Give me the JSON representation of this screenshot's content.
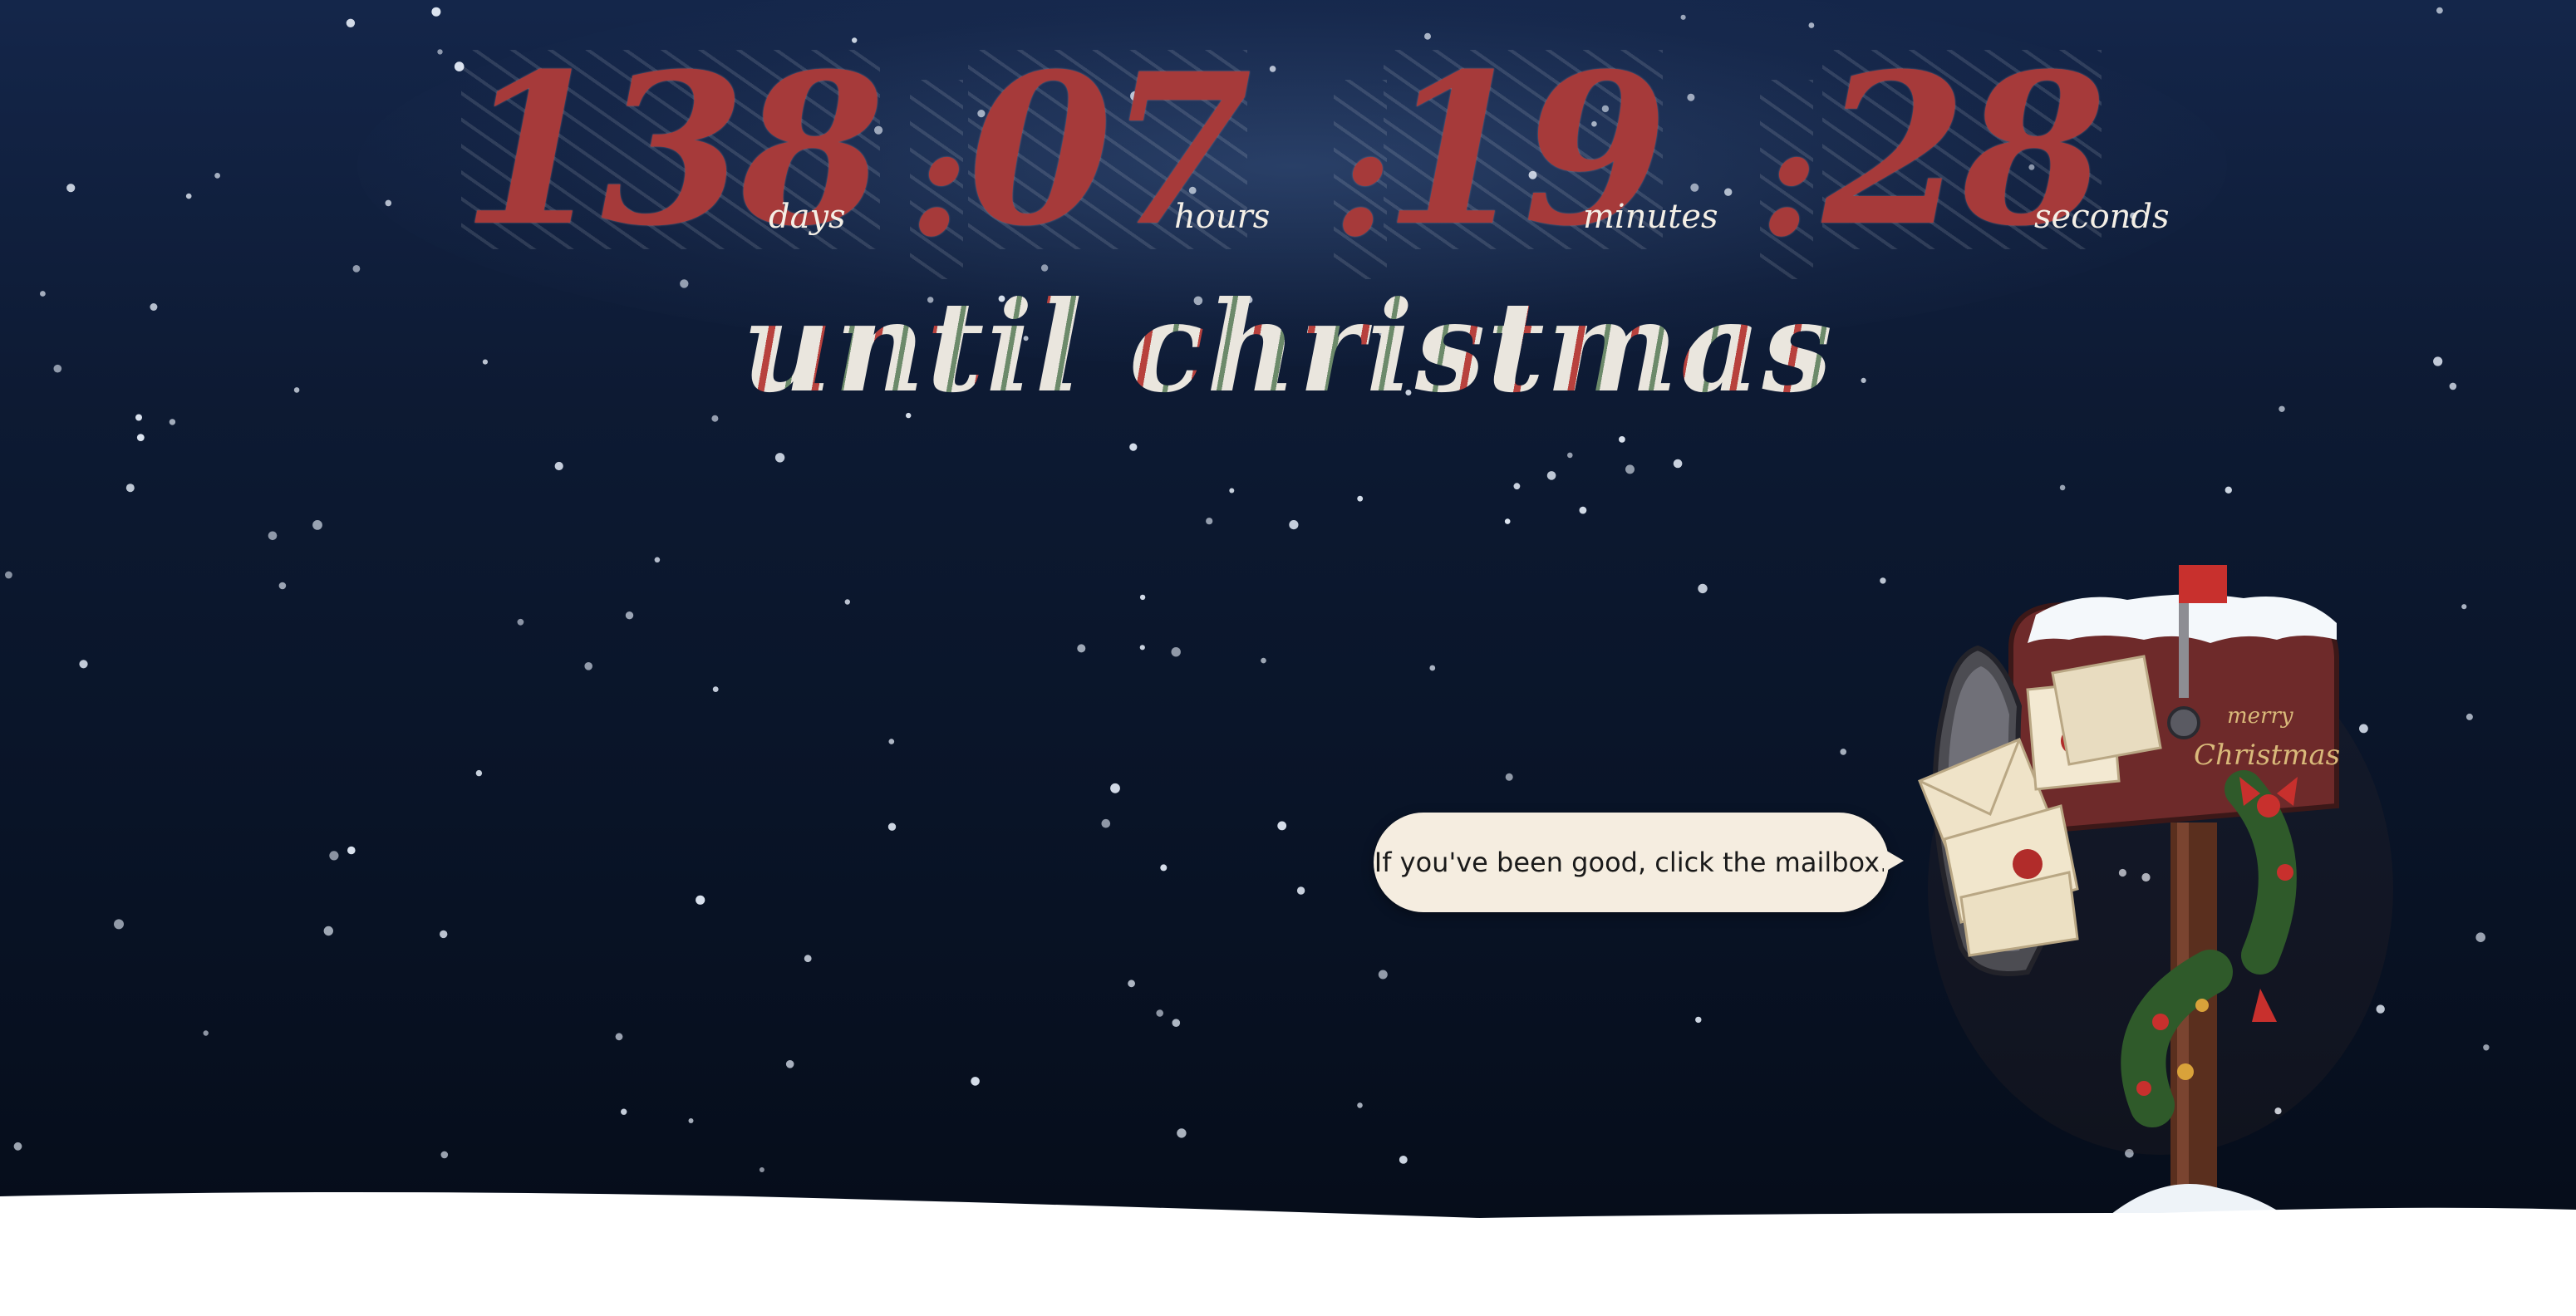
{
  "countdown": {
    "days": {
      "value": "138",
      "label": "days"
    },
    "hours": {
      "value": "07",
      "label": "hours"
    },
    "minutes": {
      "value": "19",
      "label": "minutes"
    },
    "seconds": {
      "value": "28",
      "label": "seconds"
    },
    "separator": ":"
  },
  "title": "until christmas",
  "prompt": "If you've been good, click the mailbox.",
  "mailbox": {
    "sign": "merry Christmas",
    "icon": "mailbox-icon"
  },
  "colors": {
    "background_top": "#14264a",
    "background_bottom": "#050b17",
    "digit_red": "#a63a3a",
    "bubble": "#f5ede0",
    "snow": "#ffffff"
  }
}
